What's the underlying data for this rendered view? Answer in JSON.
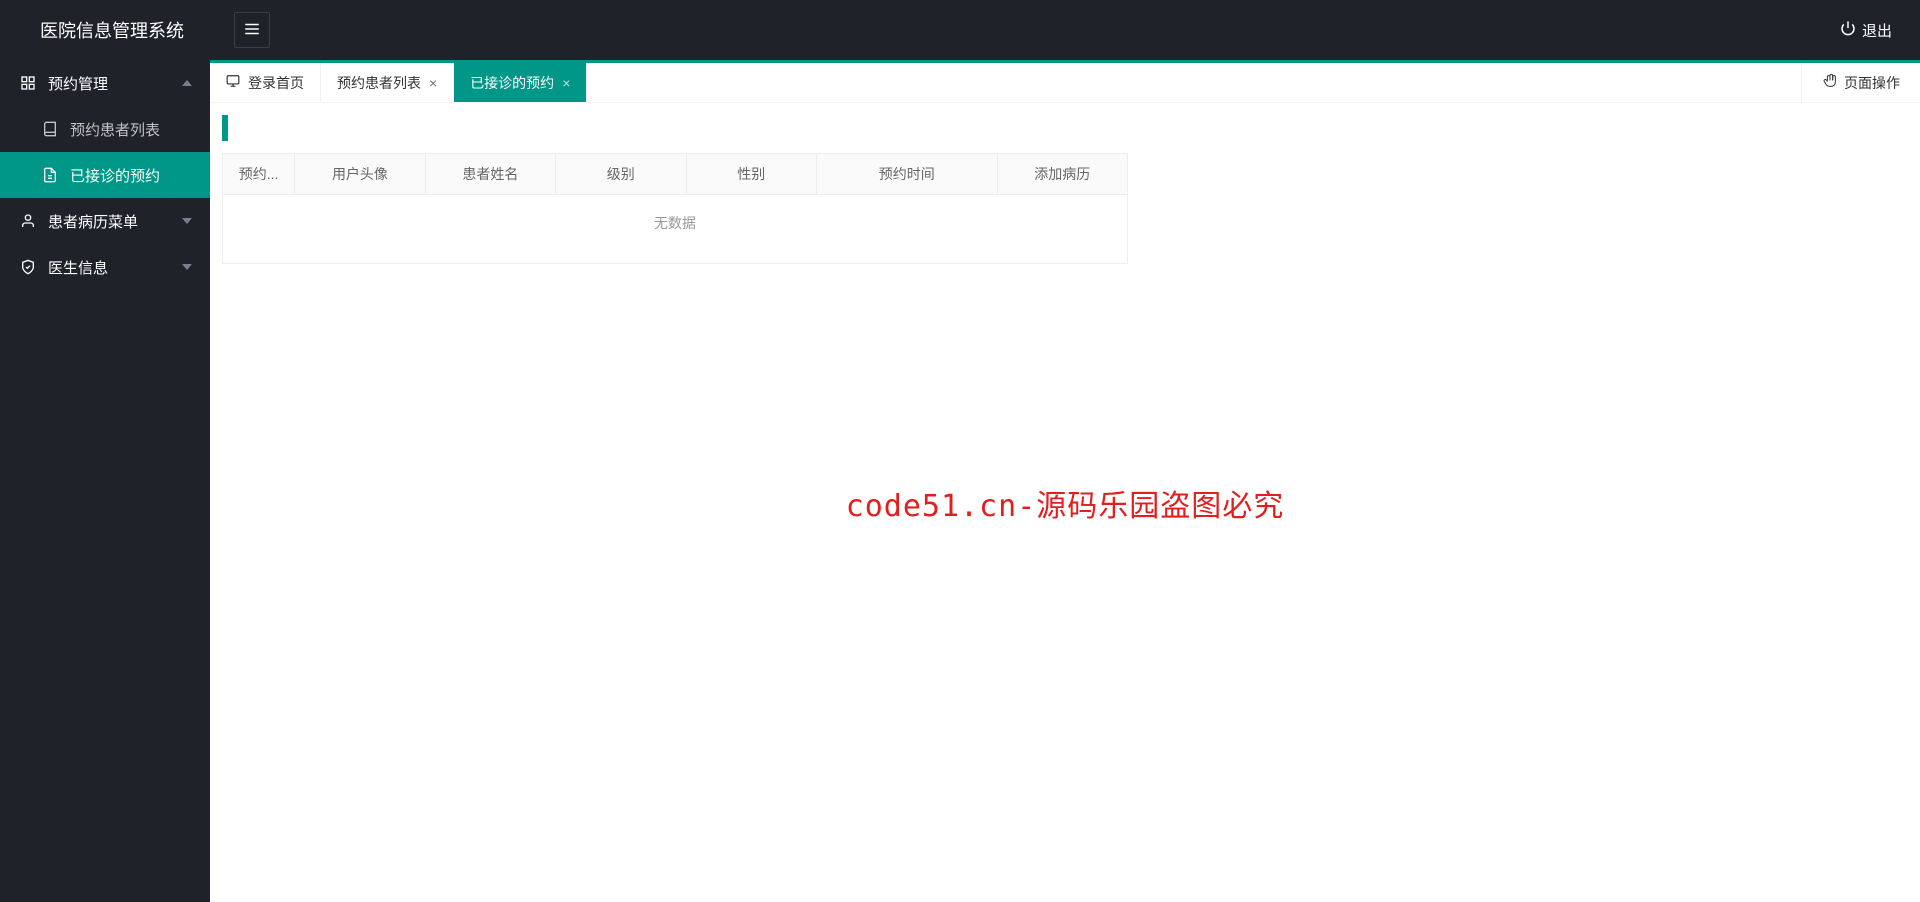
{
  "header": {
    "title": "医院信息管理系统",
    "logout": "退出"
  },
  "sidebar": {
    "items": [
      {
        "label": "预约管理",
        "expanded": true
      },
      {
        "label": "预约患者列表",
        "sub": true
      },
      {
        "label": "已接诊的预约",
        "sub": true,
        "active": true
      },
      {
        "label": "患者病历菜单",
        "expanded": false
      },
      {
        "label": "医生信息",
        "expanded": false
      }
    ]
  },
  "tabs": {
    "items": [
      {
        "label": "登录首页",
        "closable": false,
        "home": true
      },
      {
        "label": "预约患者列表",
        "closable": true
      },
      {
        "label": "已接诊的预约",
        "closable": true,
        "active": true
      }
    ],
    "pageOps": "页面操作"
  },
  "table": {
    "columns": [
      "预约...",
      "用户头像",
      "患者姓名",
      "级别",
      "性别",
      "预约时间",
      "添加病历"
    ],
    "widths": [
      72,
      130,
      130,
      130,
      130,
      180,
      130
    ],
    "noData": "无数据"
  },
  "watermark": "code51.cn-源码乐园盗图必究"
}
